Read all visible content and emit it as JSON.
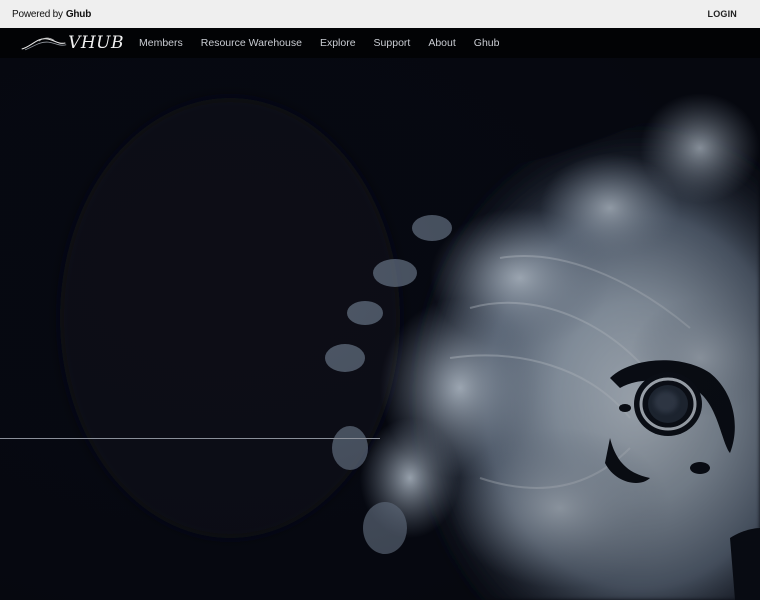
{
  "topbar": {
    "powered_prefix": "Powered by",
    "powered_brand": "Ghub",
    "login_label": "LOGIN"
  },
  "nav": {
    "logo_text": "VHUB",
    "items": [
      "Members",
      "Resource Warehouse",
      "Explore",
      "Support",
      "About",
      "Ghub"
    ]
  },
  "colors": {
    "topbar_bg": "#efefef",
    "nav_bg": "#020305",
    "hero_bg": "#060810"
  }
}
